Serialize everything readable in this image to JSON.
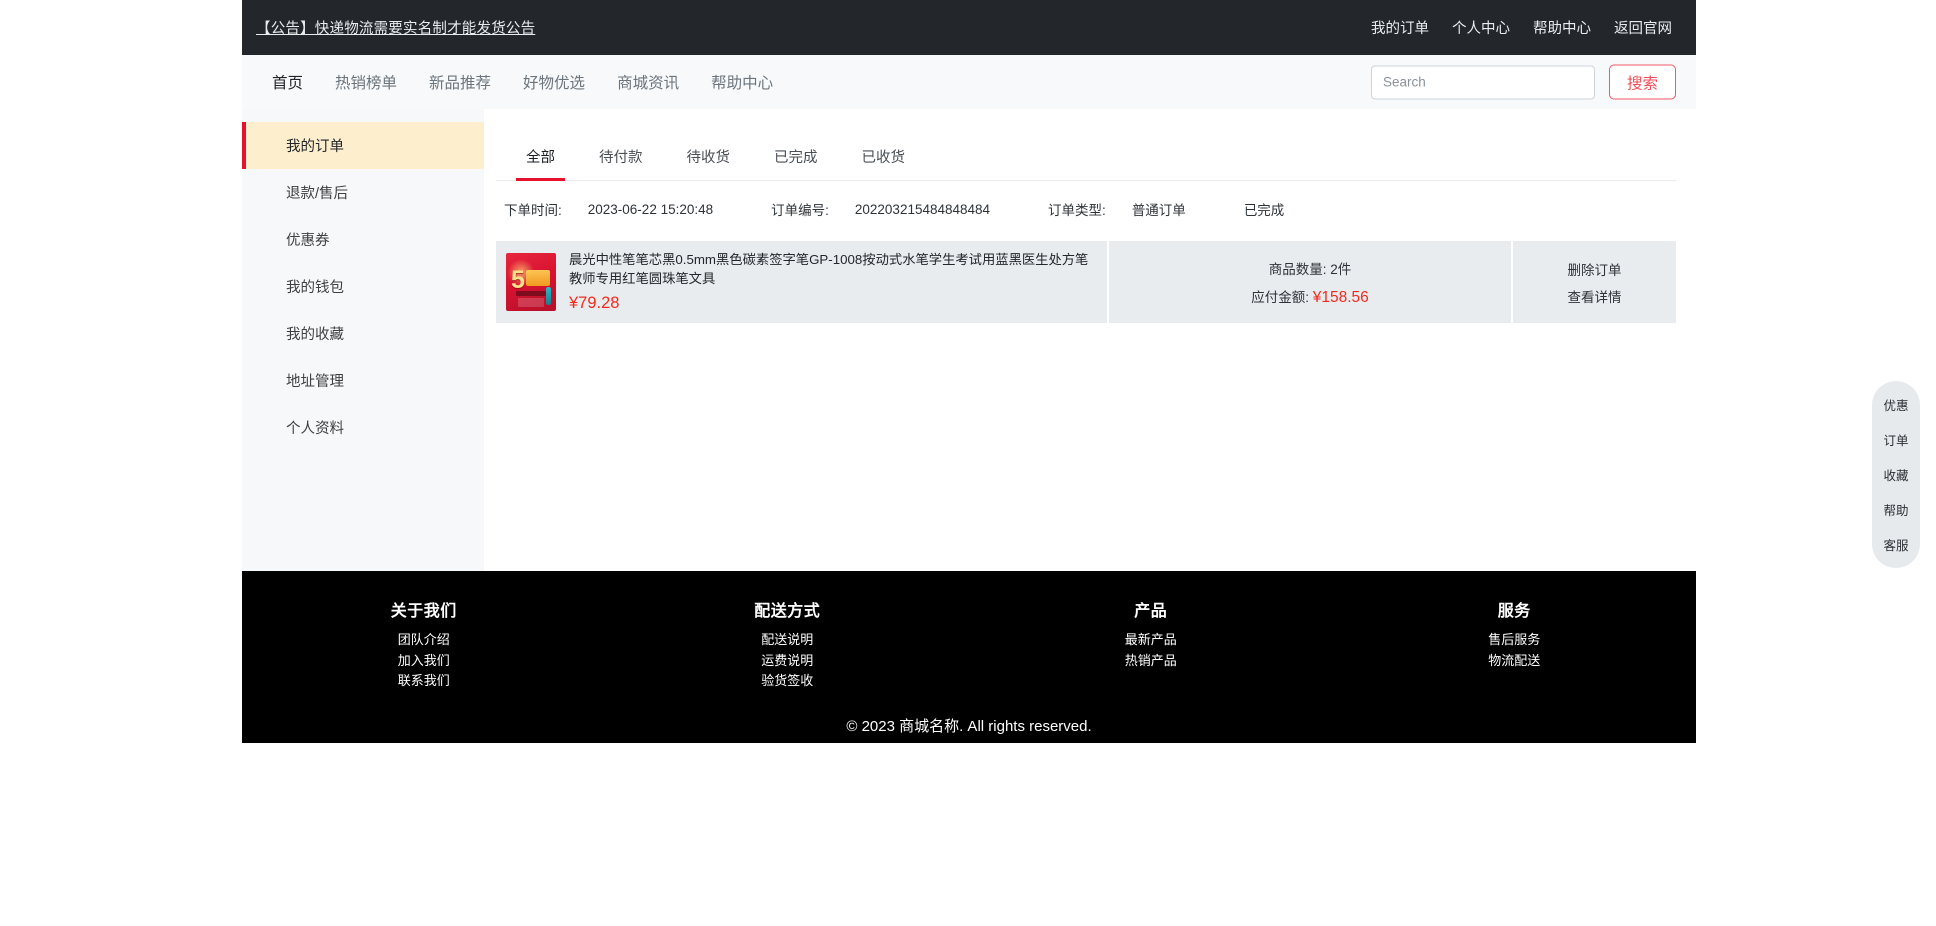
{
  "topbar": {
    "announcement": "【公告】快递物流需要实名制才能发货公告",
    "nav": [
      {
        "label": "我的订单"
      },
      {
        "label": "个人中心"
      },
      {
        "label": "帮助中心"
      },
      {
        "label": "返回官网"
      }
    ]
  },
  "mainnav": {
    "links": [
      {
        "label": "首页",
        "active": true
      },
      {
        "label": "热销榜单",
        "active": false
      },
      {
        "label": "新品推荐",
        "active": false
      },
      {
        "label": "好物优选",
        "active": false
      },
      {
        "label": "商城资讯",
        "active": false
      },
      {
        "label": "帮助中心",
        "active": false
      }
    ],
    "search": {
      "placeholder": "Search",
      "value": "",
      "button_label": "搜索"
    }
  },
  "sidebar": {
    "items": [
      {
        "label": "我的订单",
        "active": true
      },
      {
        "label": "退款/售后",
        "active": false
      },
      {
        "label": "优惠券",
        "active": false
      },
      {
        "label": "我的钱包",
        "active": false
      },
      {
        "label": "我的收藏",
        "active": false
      },
      {
        "label": "地址管理",
        "active": false
      },
      {
        "label": "个人资料",
        "active": false
      }
    ]
  },
  "main": {
    "tabs": [
      {
        "label": "全部",
        "active": true
      },
      {
        "label": "待付款",
        "active": false
      },
      {
        "label": "待收货",
        "active": false
      },
      {
        "label": "已完成",
        "active": false
      },
      {
        "label": "已收货",
        "active": false
      }
    ],
    "order": {
      "time_label": "下单时间:",
      "time_value": "2023-06-22 15:20:48",
      "number_label": "订单编号:",
      "number_value": "202203215484848484",
      "type_label": "订单类型:",
      "type_value": "普通订单",
      "status": "已完成",
      "product": {
        "title": "晨光中性笔笔芯黑0.5mm黑色碳素签字笔GP-1008按动式水笔学生考试用蓝黑医生处方笔教师专用红笔圆珠笔文具",
        "price": "¥79.28",
        "thumb_alt": "促销海报缩略图"
      },
      "quantity_label": "商品数量:",
      "quantity_value": "2件",
      "payable_label": "应付金额:",
      "payable_value": "¥158.56",
      "actions": [
        {
          "label": "删除订单"
        },
        {
          "label": "查看详情"
        }
      ]
    }
  },
  "footer": {
    "columns": [
      {
        "title": "关于我们",
        "links": [
          {
            "label": "团队介绍"
          },
          {
            "label": "加入我们"
          },
          {
            "label": "联系我们"
          }
        ]
      },
      {
        "title": "配送方式",
        "links": [
          {
            "label": "配送说明"
          },
          {
            "label": "运费说明"
          },
          {
            "label": "验货签收"
          }
        ]
      },
      {
        "title": "产品",
        "links": [
          {
            "label": "最新产品"
          },
          {
            "label": "热销产品"
          }
        ]
      },
      {
        "title": "服务",
        "links": [
          {
            "label": "售后服务"
          },
          {
            "label": "物流配送"
          }
        ]
      }
    ],
    "copyright": "© 2023 商城名称. All rights reserved."
  },
  "floatbar": {
    "items": [
      {
        "label": "优惠"
      },
      {
        "label": "订单"
      },
      {
        "label": "收藏"
      },
      {
        "label": "帮助"
      },
      {
        "label": "客服"
      }
    ]
  },
  "colors": {
    "accent_red": "#e8112d",
    "price_red": "#f02b1d",
    "topbar_bg": "#23272b",
    "active_sidebar_bg": "#fdeecd",
    "card_bg": "#e9ecef",
    "footer_bg": "#000000"
  }
}
